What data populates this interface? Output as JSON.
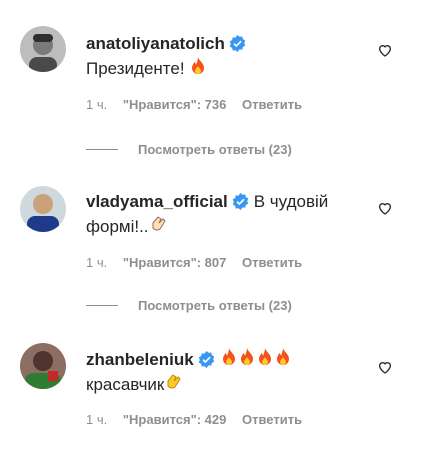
{
  "comments": [
    {
      "username": "anatoliyanatolich",
      "text": "Президенте!",
      "emoji": [
        "fire-emoji"
      ],
      "time": "1 ч.",
      "likes": "\"Нравится\": 736",
      "reply_label": "Ответить",
      "view_replies": "Посмотреть ответы (23)"
    },
    {
      "username": "vladyama_official",
      "text_line1": "В чудовій",
      "text_line2": "формі!..",
      "emoji": [
        "clapping-hands-emoji"
      ],
      "time": "1 ч.",
      "likes": "\"Нравится\": 807",
      "reply_label": "Ответить",
      "view_replies": "Посмотреть ответы (23)"
    },
    {
      "username": "zhanbeleniuk",
      "text": "красавчик",
      "emoji_line1": [
        "fire-emoji",
        "fire-emoji",
        "fire-emoji",
        "fire-emoji"
      ],
      "emoji_line2": [
        "clapping-hands-emoji"
      ],
      "time": "1 ч.",
      "likes": "\"Нравится\": 429",
      "reply_label": "Ответить"
    }
  ],
  "colors": {
    "text": "#262626",
    "secondary": "#8e8e8e",
    "verified": "#3897f0"
  },
  "icons": {
    "verified": "verified-badge-icon",
    "like": "heart-outline-icon"
  }
}
